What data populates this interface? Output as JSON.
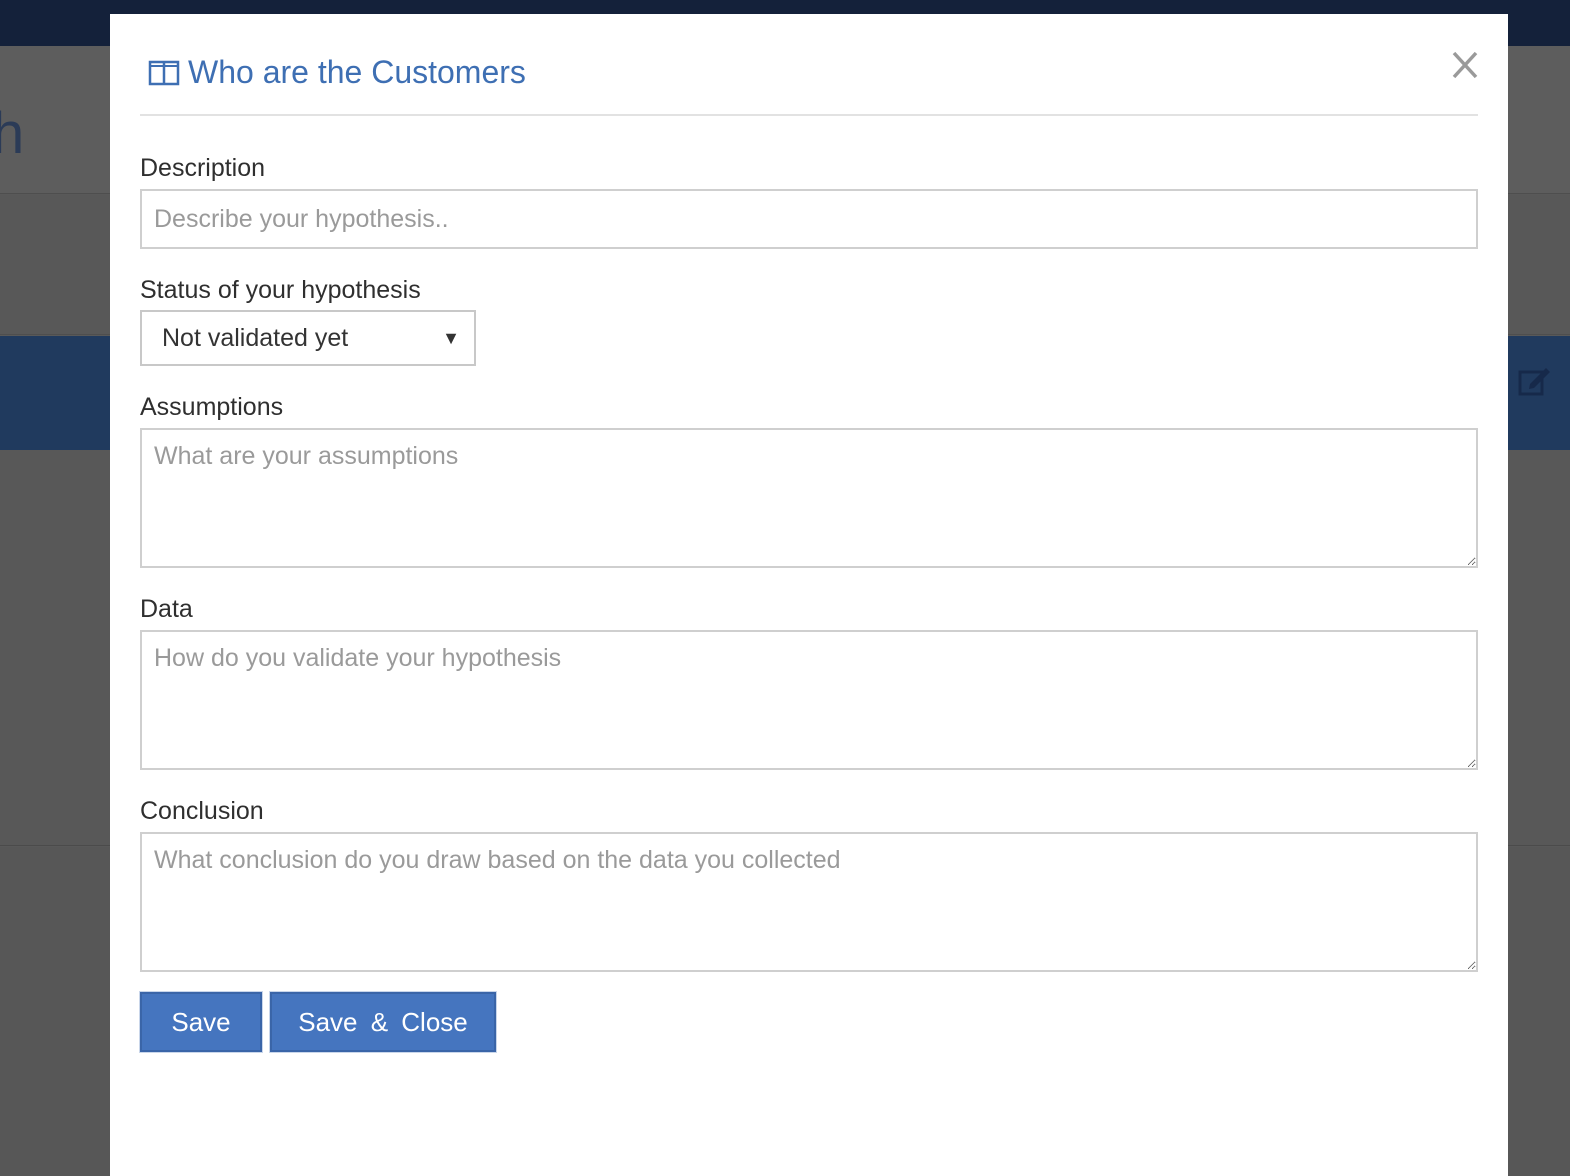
{
  "background": {
    "heading_fragment": "h"
  },
  "modal": {
    "title": "Who are the Customers",
    "close_symbol": "✕",
    "fields": {
      "description": {
        "label": "Description",
        "placeholder": "Describe your hypothesis..",
        "value": ""
      },
      "status": {
        "label": "Status of your hypothesis",
        "selected": "Not validated yet"
      },
      "assumptions": {
        "label": "Assumptions",
        "placeholder": "What are your assumptions",
        "value": ""
      },
      "data": {
        "label": "Data",
        "placeholder": "How do you validate your hypothesis",
        "value": ""
      },
      "conclusion": {
        "label": "Conclusion",
        "placeholder": "What conclusion do you draw based on the data you collected",
        "value": ""
      }
    },
    "buttons": {
      "save": "Save",
      "save_close": "Save & Close"
    }
  },
  "icons": {
    "title_icon": "columns-icon",
    "close_icon": "close-icon",
    "select_arrow": "caret-down-icon",
    "edit_icon": "edit-icon"
  },
  "colors": {
    "accent": "#3e6fb3",
    "button": "#4575bf",
    "topbar": "#14213a",
    "blue_band": "#203a5e"
  }
}
